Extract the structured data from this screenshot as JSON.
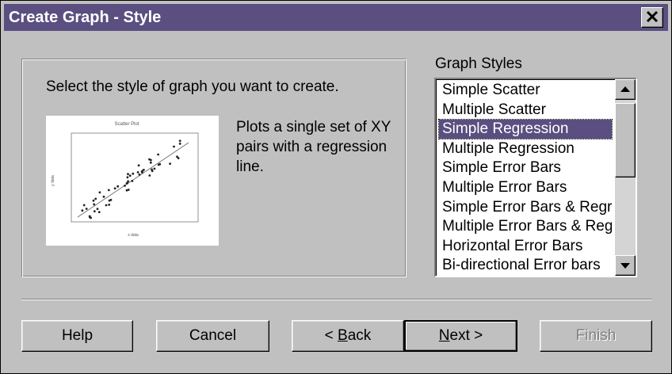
{
  "window": {
    "title": "Create Graph - Style",
    "close_icon": "close-icon",
    "titlebar_color": "#5a4f80"
  },
  "main": {
    "prompt": "Select the style of graph you want to create.",
    "description": "Plots a single set of XY pairs with a regression line.",
    "preview": {
      "title": "Scatter Plot",
      "xlabel": "x data",
      "ylabel": "y data"
    }
  },
  "graph_styles": {
    "label": "Graph Styles",
    "selected_index": 2,
    "items": [
      "Simple Scatter",
      "Multiple Scatter",
      "Simple Regression",
      "Multiple Regression",
      "Simple Error Bars",
      "Multiple Error Bars",
      "Simple Error Bars & Regression",
      "Multiple Error Bars & Regression",
      "Horizontal Error Bars",
      "Bi-directional Error bars"
    ]
  },
  "buttons": {
    "help": "Help",
    "cancel": "Cancel",
    "back_prefix": "< ",
    "back_accel": "B",
    "back_rest": "ack",
    "next_accel": "N",
    "next_rest": "ext >",
    "finish": "Finish"
  }
}
